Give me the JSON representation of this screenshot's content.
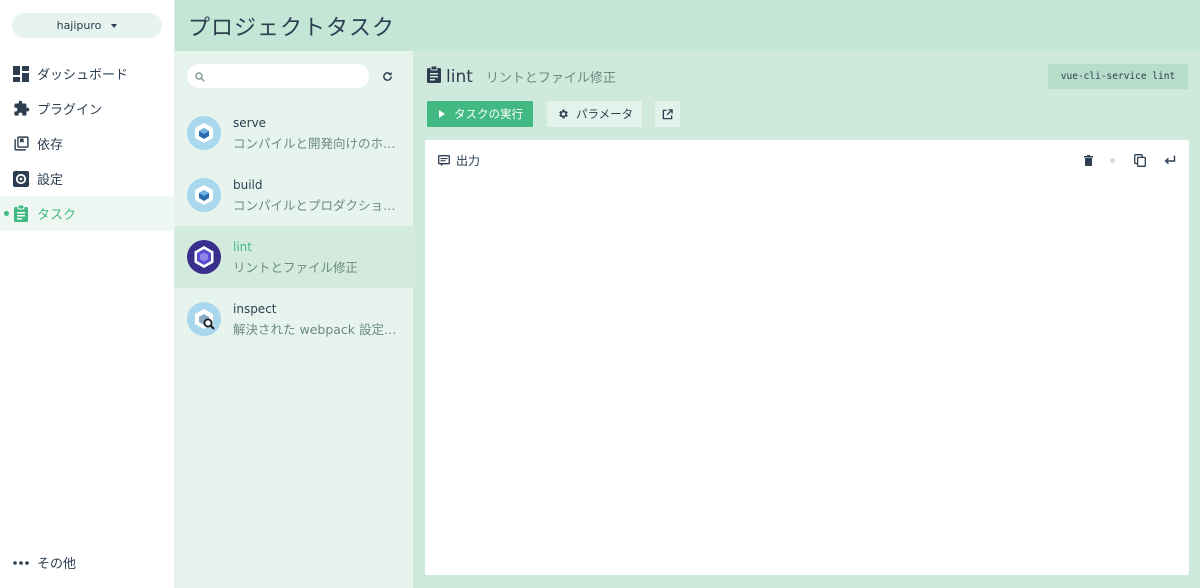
{
  "nav": {
    "project": "hajipuro",
    "items": [
      {
        "label": "ダッシュボード",
        "icon": "dashboard-icon"
      },
      {
        "label": "プラグイン",
        "icon": "puzzle-icon"
      },
      {
        "label": "依存",
        "icon": "library-books-icon"
      },
      {
        "label": "設定",
        "icon": "settings-gear-icon"
      },
      {
        "label": "タスク",
        "icon": "clipboard-icon"
      }
    ],
    "more": "その他"
  },
  "header": {
    "title": "プロジェクトタスク"
  },
  "search": {
    "placeholder": "",
    "value": ""
  },
  "tasks": [
    {
      "name": "serve",
      "description": "コンパイルと開発向けのホットリロード"
    },
    {
      "name": "build",
      "description": "コンパイルとプロダクション向けの最小化"
    },
    {
      "name": "lint",
      "description": "リントとファイル修正"
    },
    {
      "name": "inspect",
      "description": "解決された webpack 設定を検査"
    }
  ],
  "detail": {
    "name": "lint",
    "description": "リントとファイル修正",
    "command": "vue-cli-service lint",
    "run_label": "タスクの実行",
    "params_label": "パラメータ",
    "output_label": "出力"
  },
  "colors": {
    "accent": "#42b983",
    "header_bg": "#c3e6d6",
    "list_bg": "#e7f4ee",
    "detail_bg": "#cfe9dd"
  }
}
